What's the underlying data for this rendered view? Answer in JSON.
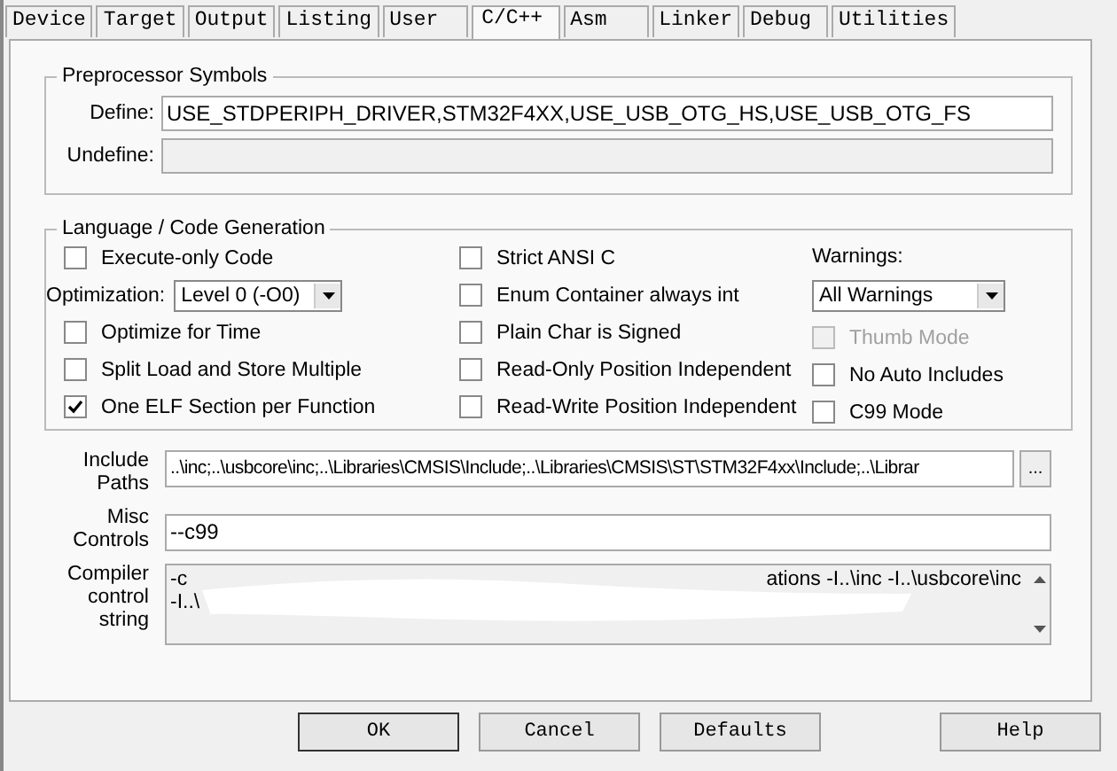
{
  "tabs": [
    {
      "label": "Device",
      "selected": false
    },
    {
      "label": "Target",
      "selected": false
    },
    {
      "label": "Output",
      "selected": false
    },
    {
      "label": "Listing",
      "selected": false
    },
    {
      "label": "User",
      "selected": false
    },
    {
      "label": "C/C++",
      "selected": true
    },
    {
      "label": "Asm",
      "selected": false
    },
    {
      "label": "Linker",
      "selected": false
    },
    {
      "label": "Debug",
      "selected": false
    },
    {
      "label": "Utilities",
      "selected": false
    }
  ],
  "preprocessor": {
    "title": "Preprocessor Symbols",
    "define": {
      "label": "Define:",
      "value": "USE_STDPERIPH_DRIVER,STM32F4XX,USE_USB_OTG_HS,USE_USB_OTG_FS"
    },
    "undefine": {
      "label": "Undefine:",
      "disabled": true
    }
  },
  "language": {
    "title": "Language / Code Generation",
    "columns": [
      [
        {
          "kind": "checkbox",
          "label": "Execute-only Code",
          "checked": false,
          "disabled": false
        },
        {
          "kind": "dropdown",
          "label": "Optimization:",
          "value": "Level 0 (-O0)"
        },
        {
          "kind": "checkbox",
          "label": "Optimize for Time",
          "checked": false,
          "disabled": false
        },
        {
          "kind": "checkbox",
          "label": "Split Load and Store Multiple",
          "checked": false,
          "disabled": false
        },
        {
          "kind": "checkbox",
          "label": "One ELF Section per Function",
          "checked": true,
          "disabled": false
        }
      ],
      [
        {
          "kind": "checkbox",
          "label": "Strict ANSI C",
          "checked": false,
          "disabled": false
        },
        {
          "kind": "checkbox",
          "label": "Enum Container always int",
          "checked": false,
          "disabled": false
        },
        {
          "kind": "checkbox",
          "label": "Plain Char is Signed",
          "checked": false,
          "disabled": false
        },
        {
          "kind": "checkbox",
          "label": "Read-Only Position Independent",
          "checked": false,
          "disabled": false
        },
        {
          "kind": "checkbox",
          "label": "Read-Write Position Independent",
          "checked": false,
          "disabled": false
        }
      ],
      [
        {
          "kind": "label",
          "label": "Warnings:"
        },
        {
          "kind": "dropdown",
          "value": "All Warnings"
        },
        {
          "kind": "checkbox",
          "label": "Thumb Mode",
          "checked": false,
          "disabled": true
        },
        {
          "kind": "checkbox",
          "label": "No Auto Includes",
          "checked": false,
          "disabled": false
        },
        {
          "kind": "checkbox",
          "label": "C99 Mode",
          "checked": false,
          "disabled": false
        }
      ]
    ]
  },
  "include_paths": {
    "label_lines": [
      "Include",
      "Paths"
    ],
    "value": "..\\inc;..\\usbcore\\inc;..\\Libraries\\CMSIS\\Include;..\\Libraries\\CMSIS\\ST\\STM32F4xx\\Include;..\\Librar",
    "browse": "..."
  },
  "misc_controls": {
    "label_lines": [
      "Misc",
      "Controls"
    ],
    "value": "--c99"
  },
  "compiler_string": {
    "label_lines": [
      "Compiler",
      "control",
      "string"
    ],
    "line_1_start": "-c",
    "line_1_end": "ations -I..\\inc -I..\\usbcore\\inc",
    "line_2_start": "-I..\\"
  },
  "buttons": [
    {
      "label": "OK",
      "kind": "default"
    },
    {
      "label": "Cancel",
      "kind": "normal"
    },
    {
      "label": "Defaults",
      "kind": "normal"
    },
    {
      "label": "Help",
      "kind": "help"
    }
  ]
}
